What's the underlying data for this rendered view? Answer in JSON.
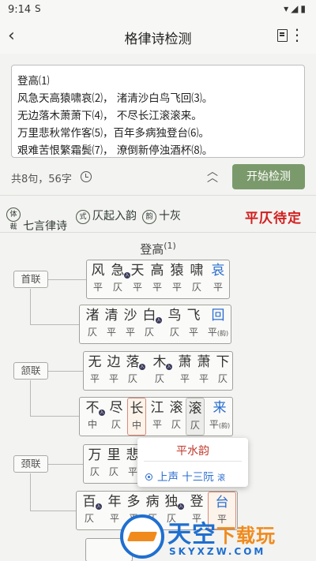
{
  "status_bar": {
    "time": "9:14",
    "sim_icon": "S",
    "right_icons": "▾◢▮"
  },
  "app_bar": {
    "title": "格律诗检测",
    "back_icon": "‹",
    "more_icon": "⋮"
  },
  "input": {
    "lines": [
      "登高⑴",
      "风急天高猿啸哀⑵， 渚清沙白鸟飞回⑶。",
      "无边落木萧萧下⑷， 不尽长江滚滚来。",
      "万里悲秋常作客⑸，百年多病独登台⑹。",
      "艰难苦恨繁霜鬓⑺， 潦倒新停浊酒杯⑻。"
    ]
  },
  "info": {
    "count": "共8句，56字",
    "collapse_icon": "︽\n︿",
    "start_button": "开始检测"
  },
  "tags": [
    {
      "seal": "体裁",
      "text": "七言律诗"
    },
    {
      "seal": "式",
      "text": "仄起入韵"
    },
    {
      "seal": "韵",
      "text": "十灰"
    }
  ],
  "status_text": "平仄待定",
  "poem_title": "登高",
  "poem_title_note": "(1)",
  "sections": [
    "首联",
    "颔联",
    "颈联"
  ],
  "lines": [
    {
      "chars": [
        "风",
        "急",
        "天",
        "高",
        "猿",
        "啸",
        "哀"
      ],
      "tones": [
        "平",
        "仄",
        "平",
        "平",
        "平",
        "仄",
        "平"
      ]
    },
    {
      "chars": [
        "渚",
        "清",
        "沙",
        "白",
        "鸟",
        "飞",
        "回"
      ],
      "tones": [
        "仄",
        "平",
        "平",
        "仄",
        "仄",
        "平",
        "平"
      ]
    },
    {
      "chars": [
        "无",
        "边",
        "落",
        "木",
        "萧",
        "萧",
        "下"
      ],
      "tones": [
        "平",
        "平",
        "仄",
        "仄",
        "平",
        "平",
        "仄"
      ]
    },
    {
      "chars": [
        "不",
        "尽",
        "长",
        "江",
        "滚",
        "滚",
        "来"
      ],
      "tones": [
        "中",
        "仄",
        "中",
        "平",
        "仄",
        "仄",
        "平"
      ]
    },
    {
      "chars": [
        "万",
        "里",
        "悲",
        "秋",
        "常",
        "作",
        "客"
      ],
      "tones": [
        "仄",
        "仄",
        "平",
        "平",
        "平",
        "仄",
        "仄"
      ]
    },
    {
      "chars": [
        "百",
        "年",
        "多",
        "病",
        "独",
        "登",
        "台"
      ],
      "tones": [
        "仄",
        "平",
        "平",
        "仄",
        "仄",
        "平",
        "平"
      ]
    }
  ],
  "rhyme_mark": "(韵)",
  "popup": {
    "title": "平水韵",
    "item": "上声 十三阮",
    "item_note": "滚"
  },
  "watermark": {
    "title_a": "天空",
    "title_b": "下载玩",
    "url": "SKYXZW.COM"
  },
  "colors": {
    "accent_green": "#7b9a6c",
    "status_red": "#d21f1f",
    "rhyme_blue": "#2b6ed0"
  }
}
